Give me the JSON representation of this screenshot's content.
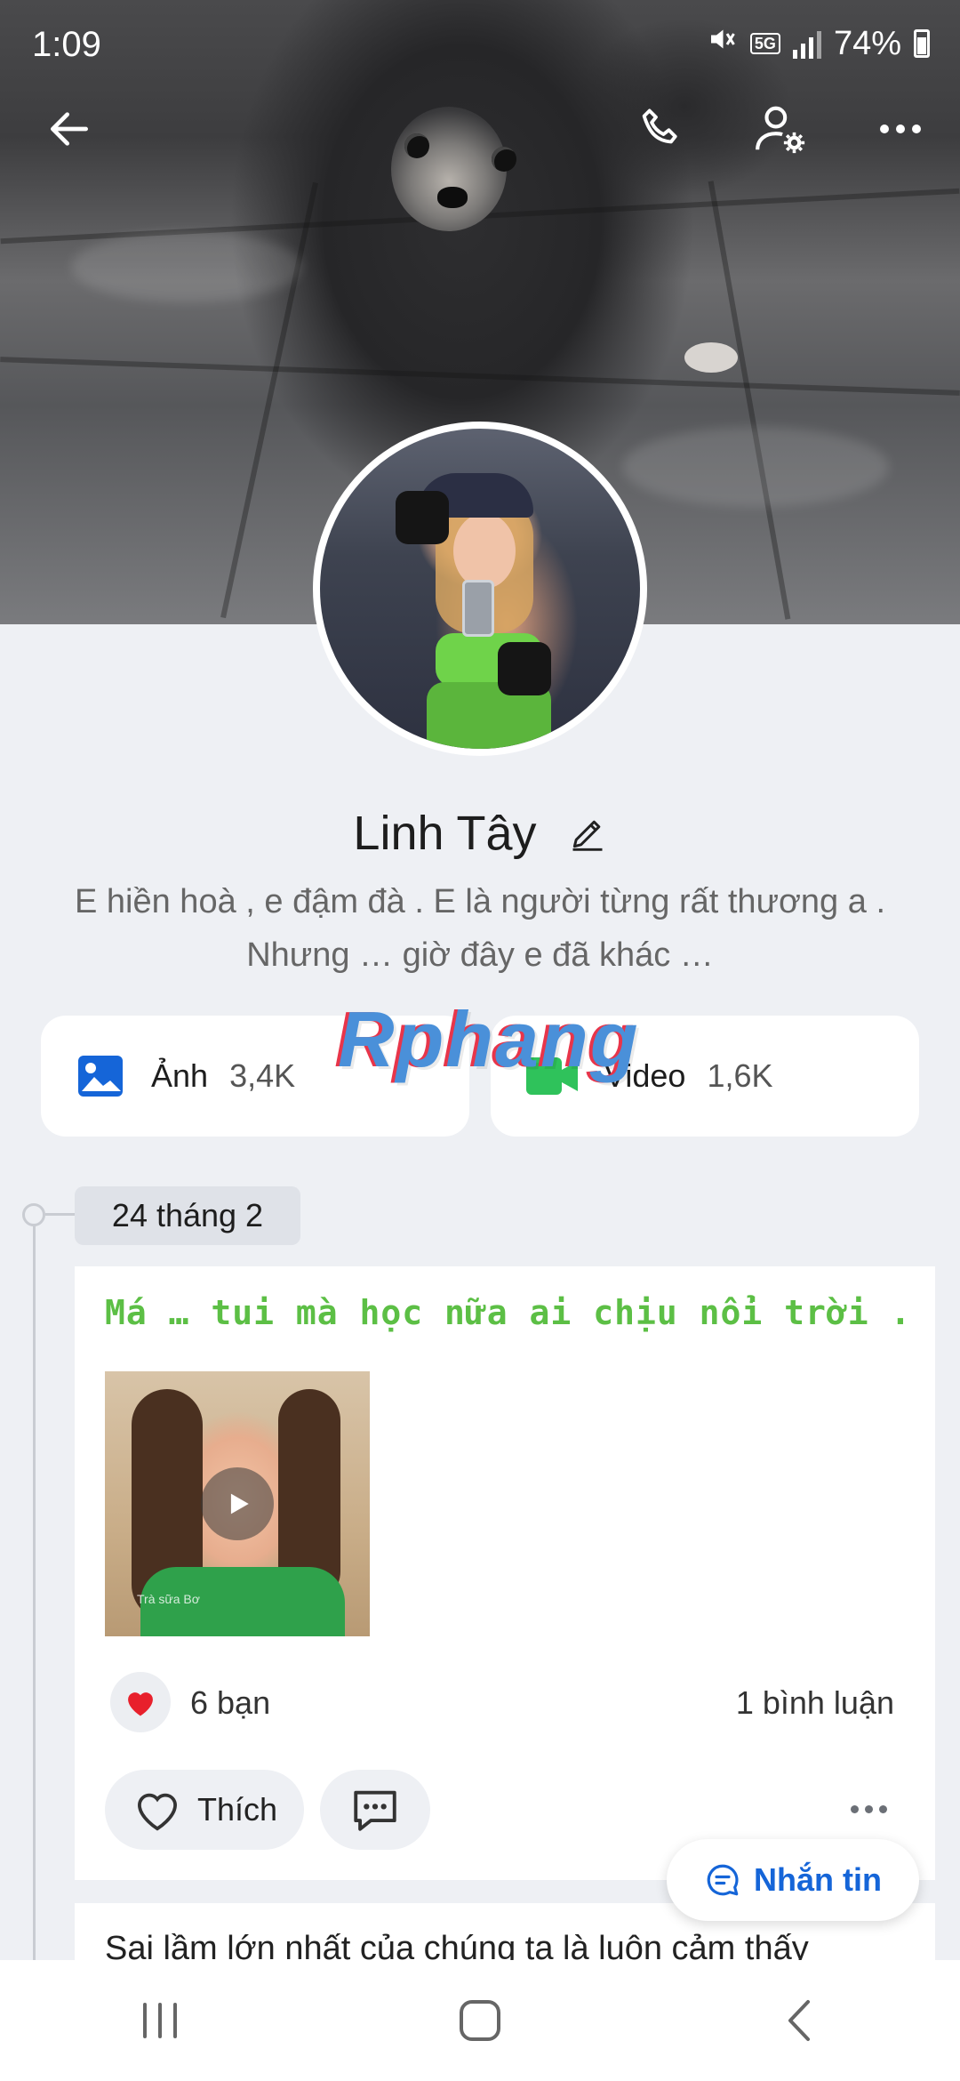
{
  "status_bar": {
    "time": "1:09",
    "network": "5G",
    "battery": "74%"
  },
  "profile": {
    "name": "Linh Tây",
    "bio_line1": "E hiền hoà , e đậm đà . E là người từng rất thương a .",
    "bio_line2": "Nhưng … giờ đây e đã khác …"
  },
  "media": [
    {
      "label": "Ảnh",
      "count": "3,4K",
      "icon": "photo-icon",
      "color": "#1565d8"
    },
    {
      "label": "Video",
      "count": "1,6K",
      "icon": "video-camera-icon",
      "color": "#2fc25b"
    }
  ],
  "watermark": "Rphang",
  "timeline": {
    "date": "24 tháng 2",
    "post": {
      "text": "Má … tui mà học nữa ai chịu nổi trời .",
      "text_color": "#5cbf45",
      "thumb_caption": "Trà sữa Bơ",
      "reaction_count": "6 bạn",
      "comment_count": "1 bình luận",
      "like_label": "Thích"
    },
    "next_post_text": "Sai lầm lớn nhất của chúng ta là luôn cảm thấy"
  },
  "message_button": "Nhắn tin",
  "colors": {
    "accent": "#1565d8",
    "background": "#eef0f4",
    "heart": "#e8202c"
  }
}
